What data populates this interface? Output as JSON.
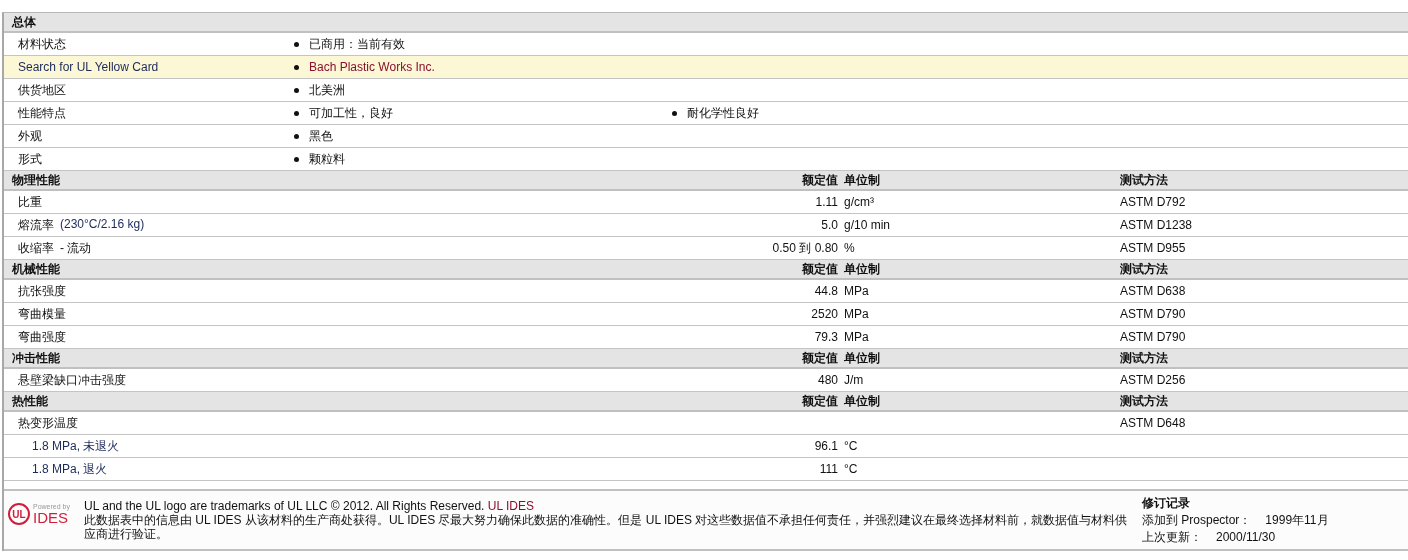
{
  "sections": [
    {
      "title": "总体",
      "kind": "general",
      "rows": [
        {
          "label": "材料状态",
          "kind": "plain",
          "highlighted": false,
          "values": [
            "已商用：当前有效"
          ]
        },
        {
          "label": "Search for UL Yellow Card",
          "kind": "link",
          "highlighted": true,
          "values": [
            "Bach Plastic Works Inc."
          ]
        },
        {
          "label": "供货地区",
          "kind": "plain",
          "highlighted": false,
          "values": [
            "北美洲"
          ]
        },
        {
          "label": "性能特点",
          "kind": "plain",
          "highlighted": false,
          "values": [
            "可加工性，良好",
            "耐化学性良好"
          ]
        },
        {
          "label": "外观",
          "kind": "plain",
          "highlighted": false,
          "values": [
            "黑色"
          ]
        },
        {
          "label": "形式",
          "kind": "plain",
          "highlighted": false,
          "values": [
            "颗粒料"
          ]
        }
      ]
    },
    {
      "title": "物理性能",
      "kind": "property",
      "value_heading": "额定值",
      "unit_heading": "单位制",
      "method_heading": "测试方法",
      "rows": [
        {
          "label": "比重",
          "value": "1.11",
          "unit": "g/cm³",
          "method": "ASTM D792"
        },
        {
          "label": "熔流率",
          "note": "(230°C/2.16 kg)",
          "value": "5.0",
          "unit": "g/10 min",
          "method": "ASTM D1238"
        },
        {
          "label": "收缩率",
          "qualifier": "- 流动",
          "value": "0.50 到  0.80",
          "unit": "%",
          "method": "ASTM D955"
        }
      ]
    },
    {
      "title": "机械性能",
      "kind": "property",
      "value_heading": "额定值",
      "unit_heading": "单位制",
      "method_heading": "测试方法",
      "rows": [
        {
          "label": "抗张强度",
          "value": "44.8",
          "unit": "MPa",
          "method": "ASTM D638"
        },
        {
          "label": "弯曲模量",
          "value": "2520",
          "unit": "MPa",
          "method": "ASTM D790"
        },
        {
          "label": "弯曲强度",
          "value": "79.3",
          "unit": "MPa",
          "method": "ASTM D790"
        }
      ]
    },
    {
      "title": "冲击性能",
      "kind": "property",
      "value_heading": "额定值",
      "unit_heading": "单位制",
      "method_heading": "测试方法",
      "rows": [
        {
          "label": "悬壁梁缺口冲击强度",
          "value": "480",
          "unit": "J/m",
          "method": "ASTM D256"
        }
      ]
    },
    {
      "title": "热性能",
      "kind": "property",
      "value_heading": "额定值",
      "unit_heading": "单位制",
      "method_heading": "测试方法",
      "rows": [
        {
          "label": "热变形温度",
          "method": "ASTM D648",
          "children": [
            {
              "label": "1.8 MPa, 未退火",
              "value": "96.1",
              "unit": "°C"
            },
            {
              "label": "1.8 MPa, 退火",
              "value": "111",
              "unit": "°C"
            }
          ]
        }
      ]
    }
  ],
  "footer": {
    "logo": {
      "mark": "UL",
      "powered": "Powered by",
      "brand": "IDES"
    },
    "trademark": "UL and the UL logo are trademarks of UL LLC © 2012. All Rights Reserved.",
    "trademark_link": "UL IDES",
    "disclaimer": "此数据表中的信息由  UL IDES 从该材料的生产商处获得。UL IDES 尽最大努力确保此数据的准确性。但是  UL IDES 对这些数据值不承担任何责任，并强烈建议在最终选择材料前，就数据值与材料供应商进行验证。",
    "revision": {
      "title": "修订记录",
      "added_label": "添加到  Prospector：",
      "added": "1999年11月",
      "updated_label": "上次更新：",
      "updated": "2000/11/30"
    }
  }
}
